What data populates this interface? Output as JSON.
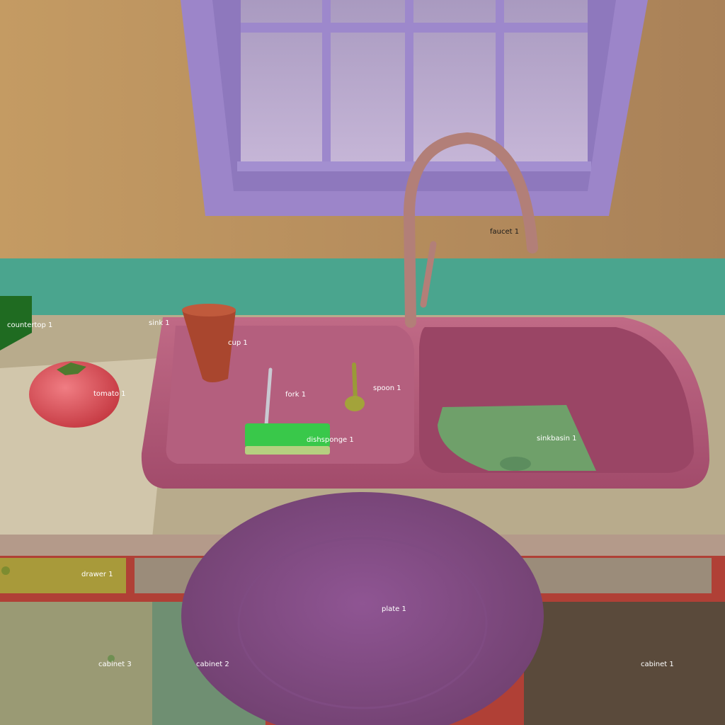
{
  "scene": {
    "colors": {
      "wall": "#b08a5e",
      "window_frame": "#9a84c8",
      "backsplash": "#4aa58e",
      "countertop": "#b8ab8c",
      "sink": "#b25a7a",
      "sink_basin_water": "#6fa06a",
      "faucet": "#b27f78",
      "plate": "#8a4f8c",
      "cabinet_front": "#8d8168",
      "cabinet_frame": "#b04036",
      "sponge": "#39c84a",
      "tomato": "#d94c55",
      "cup": "#a9462e"
    },
    "labels": {
      "faucet": "faucet 1",
      "countertop": "countertop 1",
      "sink": "sink 1",
      "cup": "cup 1",
      "tomato": "tomato 1",
      "fork": "fork 1",
      "spoon": "spoon 1",
      "dishsponge": "dishsponge 1",
      "sinkbasin": "sinkbasin 1",
      "drawer": "drawer 1",
      "plate": "plate 1",
      "cabinet3": "cabinet 3",
      "cabinet2": "cabinet 2",
      "cabinet1": "cabinet 1"
    }
  }
}
